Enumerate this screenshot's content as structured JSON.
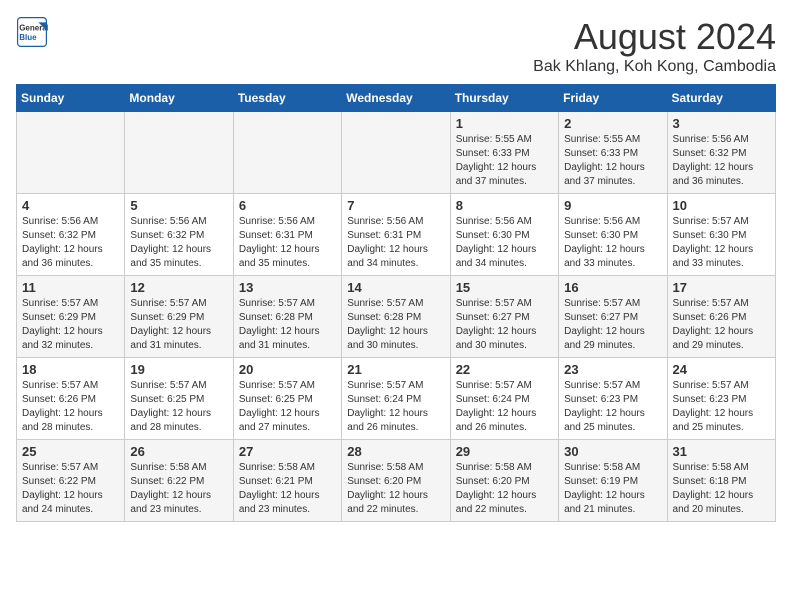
{
  "header": {
    "logo_line1": "General",
    "logo_line2": "Blue",
    "title": "August 2024",
    "subtitle": "Bak Khlang, Koh Kong, Cambodia"
  },
  "weekdays": [
    "Sunday",
    "Monday",
    "Tuesday",
    "Wednesday",
    "Thursday",
    "Friday",
    "Saturday"
  ],
  "weeks": [
    [
      {
        "day": "",
        "info": ""
      },
      {
        "day": "",
        "info": ""
      },
      {
        "day": "",
        "info": ""
      },
      {
        "day": "",
        "info": ""
      },
      {
        "day": "1",
        "info": "Sunrise: 5:55 AM\nSunset: 6:33 PM\nDaylight: 12 hours\nand 37 minutes."
      },
      {
        "day": "2",
        "info": "Sunrise: 5:55 AM\nSunset: 6:33 PM\nDaylight: 12 hours\nand 37 minutes."
      },
      {
        "day": "3",
        "info": "Sunrise: 5:56 AM\nSunset: 6:32 PM\nDaylight: 12 hours\nand 36 minutes."
      }
    ],
    [
      {
        "day": "4",
        "info": "Sunrise: 5:56 AM\nSunset: 6:32 PM\nDaylight: 12 hours\nand 36 minutes."
      },
      {
        "day": "5",
        "info": "Sunrise: 5:56 AM\nSunset: 6:32 PM\nDaylight: 12 hours\nand 35 minutes."
      },
      {
        "day": "6",
        "info": "Sunrise: 5:56 AM\nSunset: 6:31 PM\nDaylight: 12 hours\nand 35 minutes."
      },
      {
        "day": "7",
        "info": "Sunrise: 5:56 AM\nSunset: 6:31 PM\nDaylight: 12 hours\nand 34 minutes."
      },
      {
        "day": "8",
        "info": "Sunrise: 5:56 AM\nSunset: 6:30 PM\nDaylight: 12 hours\nand 34 minutes."
      },
      {
        "day": "9",
        "info": "Sunrise: 5:56 AM\nSunset: 6:30 PM\nDaylight: 12 hours\nand 33 minutes."
      },
      {
        "day": "10",
        "info": "Sunrise: 5:57 AM\nSunset: 6:30 PM\nDaylight: 12 hours\nand 33 minutes."
      }
    ],
    [
      {
        "day": "11",
        "info": "Sunrise: 5:57 AM\nSunset: 6:29 PM\nDaylight: 12 hours\nand 32 minutes."
      },
      {
        "day": "12",
        "info": "Sunrise: 5:57 AM\nSunset: 6:29 PM\nDaylight: 12 hours\nand 31 minutes."
      },
      {
        "day": "13",
        "info": "Sunrise: 5:57 AM\nSunset: 6:28 PM\nDaylight: 12 hours\nand 31 minutes."
      },
      {
        "day": "14",
        "info": "Sunrise: 5:57 AM\nSunset: 6:28 PM\nDaylight: 12 hours\nand 30 minutes."
      },
      {
        "day": "15",
        "info": "Sunrise: 5:57 AM\nSunset: 6:27 PM\nDaylight: 12 hours\nand 30 minutes."
      },
      {
        "day": "16",
        "info": "Sunrise: 5:57 AM\nSunset: 6:27 PM\nDaylight: 12 hours\nand 29 minutes."
      },
      {
        "day": "17",
        "info": "Sunrise: 5:57 AM\nSunset: 6:26 PM\nDaylight: 12 hours\nand 29 minutes."
      }
    ],
    [
      {
        "day": "18",
        "info": "Sunrise: 5:57 AM\nSunset: 6:26 PM\nDaylight: 12 hours\nand 28 minutes."
      },
      {
        "day": "19",
        "info": "Sunrise: 5:57 AM\nSunset: 6:25 PM\nDaylight: 12 hours\nand 28 minutes."
      },
      {
        "day": "20",
        "info": "Sunrise: 5:57 AM\nSunset: 6:25 PM\nDaylight: 12 hours\nand 27 minutes."
      },
      {
        "day": "21",
        "info": "Sunrise: 5:57 AM\nSunset: 6:24 PM\nDaylight: 12 hours\nand 26 minutes."
      },
      {
        "day": "22",
        "info": "Sunrise: 5:57 AM\nSunset: 6:24 PM\nDaylight: 12 hours\nand 26 minutes."
      },
      {
        "day": "23",
        "info": "Sunrise: 5:57 AM\nSunset: 6:23 PM\nDaylight: 12 hours\nand 25 minutes."
      },
      {
        "day": "24",
        "info": "Sunrise: 5:57 AM\nSunset: 6:23 PM\nDaylight: 12 hours\nand 25 minutes."
      }
    ],
    [
      {
        "day": "25",
        "info": "Sunrise: 5:57 AM\nSunset: 6:22 PM\nDaylight: 12 hours\nand 24 minutes."
      },
      {
        "day": "26",
        "info": "Sunrise: 5:58 AM\nSunset: 6:22 PM\nDaylight: 12 hours\nand 23 minutes."
      },
      {
        "day": "27",
        "info": "Sunrise: 5:58 AM\nSunset: 6:21 PM\nDaylight: 12 hours\nand 23 minutes."
      },
      {
        "day": "28",
        "info": "Sunrise: 5:58 AM\nSunset: 6:20 PM\nDaylight: 12 hours\nand 22 minutes."
      },
      {
        "day": "29",
        "info": "Sunrise: 5:58 AM\nSunset: 6:20 PM\nDaylight: 12 hours\nand 22 minutes."
      },
      {
        "day": "30",
        "info": "Sunrise: 5:58 AM\nSunset: 6:19 PM\nDaylight: 12 hours\nand 21 minutes."
      },
      {
        "day": "31",
        "info": "Sunrise: 5:58 AM\nSunset: 6:18 PM\nDaylight: 12 hours\nand 20 minutes."
      }
    ]
  ]
}
